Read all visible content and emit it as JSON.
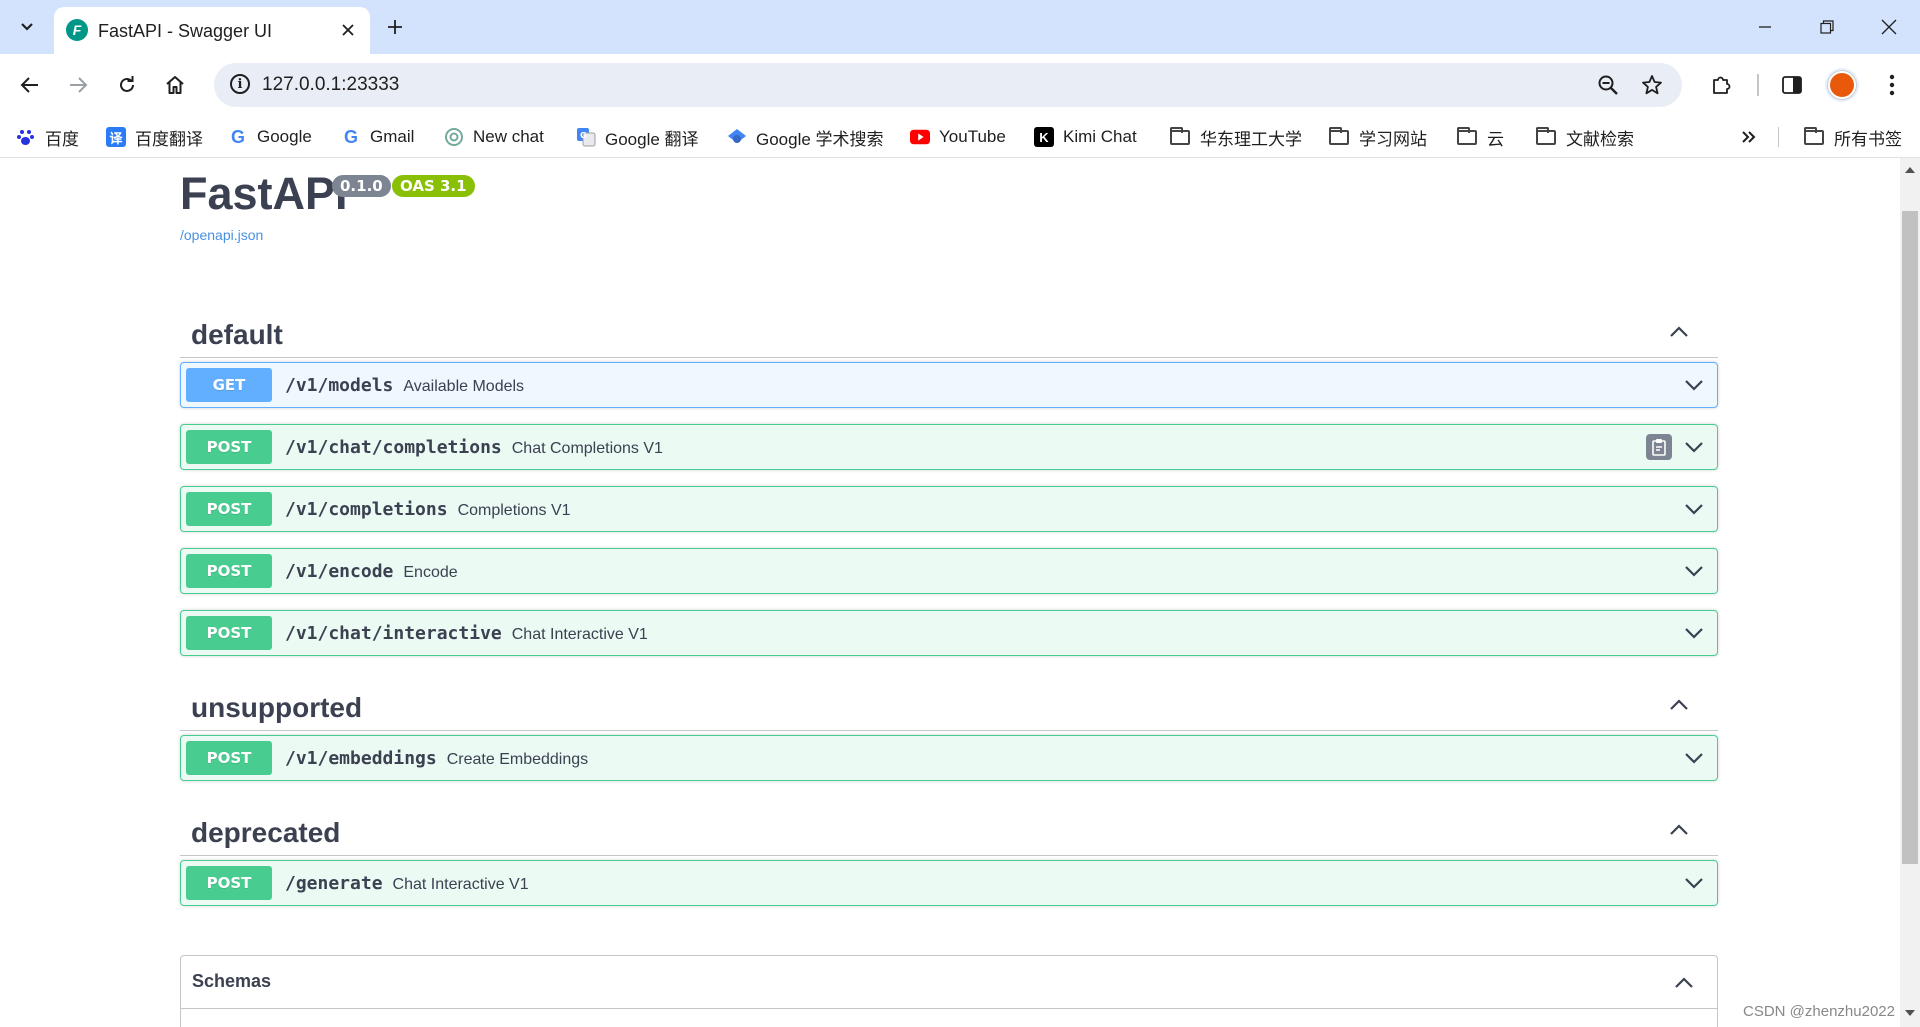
{
  "browser": {
    "tab_title": "FastAPI - Swagger UI",
    "favicon_letter": "F",
    "url": "127.0.0.1:23333",
    "bookmarks": [
      {
        "label": "百度",
        "icon": "baidu-paw-icon"
      },
      {
        "label": "百度翻译",
        "icon": "translate-icon",
        "glyph": "译"
      },
      {
        "label": "Google",
        "icon": "google-icon",
        "glyph": "G"
      },
      {
        "label": "Gmail",
        "icon": "google-icon",
        "glyph": "G"
      },
      {
        "label": "New chat",
        "icon": "openai-icon"
      },
      {
        "label": "Google 翻译",
        "icon": "google-translate-icon"
      },
      {
        "label": "Google 学术搜索",
        "icon": "scholar-icon"
      },
      {
        "label": "YouTube",
        "icon": "youtube-icon"
      },
      {
        "label": "Kimi Chat",
        "icon": "kimi-icon",
        "glyph": "K"
      },
      {
        "label": "华东理工大学",
        "icon": "folder-icon"
      },
      {
        "label": "学习网站",
        "icon": "folder-icon"
      },
      {
        "label": "云",
        "icon": "folder-icon"
      },
      {
        "label": "文献检索",
        "icon": "folder-icon"
      }
    ],
    "all_bookmarks": "所有书签"
  },
  "api": {
    "title": "FastAPI",
    "version": "0.1.0",
    "oas": "OAS 3.1",
    "openapi_link": "/openapi.json"
  },
  "tags": [
    {
      "name": "default",
      "operations": [
        {
          "method": "GET",
          "path": "/v1/models",
          "summary": "Available Models"
        },
        {
          "method": "POST",
          "path": "/v1/chat/completions",
          "summary": "Chat Completions V1"
        },
        {
          "method": "POST",
          "path": "/v1/completions",
          "summary": "Completions V1"
        },
        {
          "method": "POST",
          "path": "/v1/encode",
          "summary": "Encode"
        },
        {
          "method": "POST",
          "path": "/v1/chat/interactive",
          "summary": "Chat Interactive V1"
        }
      ]
    },
    {
      "name": "unsupported",
      "operations": [
        {
          "method": "POST",
          "path": "/v1/embeddings",
          "summary": "Create Embeddings"
        }
      ]
    },
    {
      "name": "deprecated",
      "operations": [
        {
          "method": "POST",
          "path": "/generate",
          "summary": "Chat Interactive V1"
        }
      ]
    }
  ],
  "schemas_title": "Schemas",
  "watermark": "CSDN @zhenzhu2022",
  "colors": {
    "get": "#61affe",
    "post": "#49cc90",
    "version_badge": "#7d8492",
    "oas_badge": "#89bf04",
    "link": "#4990e2"
  }
}
